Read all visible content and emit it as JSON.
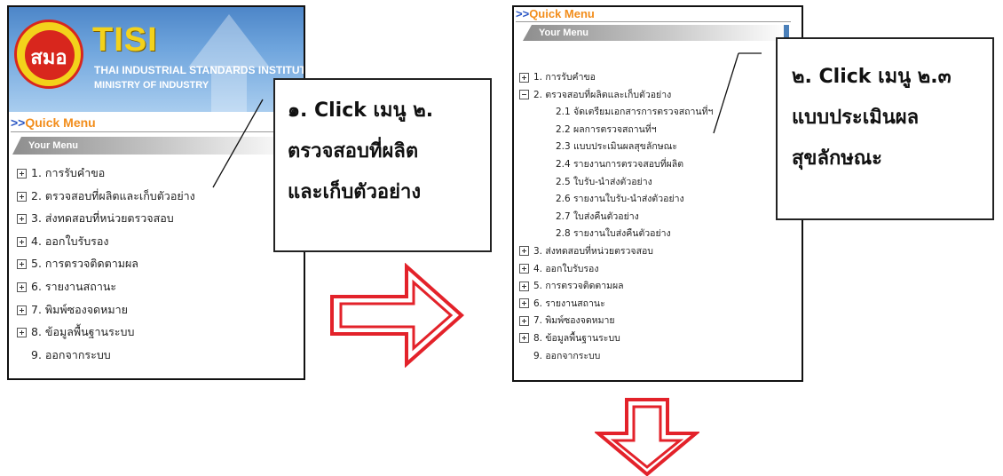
{
  "panel1": {
    "logo": {
      "abbrev": "สมอ",
      "brand": "TISI",
      "name_line1": "THAI INDUSTRIAL STANDARDS INSTITUTE",
      "name_line2": "MINISTRY OF INDUSTRY"
    },
    "quick_menu": {
      "prefix": ">>",
      "label": "Quick Menu"
    },
    "your_menu": "Your Menu",
    "menu_items": [
      {
        "label": "1. การรับคำขอ",
        "icon": "plus-box-icon"
      },
      {
        "label": "2. ตรวจสอบที่ผลิตและเก็บตัวอย่าง",
        "icon": "plus-box-icon"
      },
      {
        "label": "3. ส่งทดสอบที่หน่วยตรวจสอบ",
        "icon": "plus-box-icon"
      },
      {
        "label": "4. ออกใบรับรอง",
        "icon": "plus-box-icon"
      },
      {
        "label": "5. การตรวจติดตามผล",
        "icon": "plus-box-icon"
      },
      {
        "label": "6. รายงานสถานะ",
        "icon": "plus-box-icon"
      },
      {
        "label": "7. พิมพ์ซองจดหมาย",
        "icon": "plus-box-icon"
      },
      {
        "label": "8. ข้อมูลพื้นฐานระบบ",
        "icon": "plus-box-icon"
      },
      {
        "label": "9. ออกจากระบบ",
        "icon": "none"
      }
    ]
  },
  "callout1": {
    "lines": [
      "๑. Click เมนู ๒.",
      "ตรวจสอบที่ผลิต",
      "และเก็บตัวอย่าง"
    ]
  },
  "panel2": {
    "quick_menu": {
      "prefix": ">>",
      "label": "Quick Menu"
    },
    "your_menu": "Your Menu",
    "menu_items": [
      {
        "label": "1. การรับคำขอ",
        "icon": "plus-box-icon"
      },
      {
        "label": "2. ตรวจสอบที่ผลิตและเก็บตัวอย่าง",
        "icon": "minus-box-icon"
      },
      {
        "label": "2.1 จัดเตรียมเอกสารการตรวจสถานที่ฯ",
        "sub": true
      },
      {
        "label": "2.2 ผลการตรวจสถานที่ฯ",
        "sub": true
      },
      {
        "label": "2.3 แบบประเมินผลสุขลักษณะ",
        "sub": true
      },
      {
        "label": "2.4 รายงานการตรวจสอบที่ผลิต",
        "sub": true
      },
      {
        "label": "2.5 ใบรับ-นำส่งตัวอย่าง",
        "sub": true
      },
      {
        "label": "2.6 รายงานใบรับ-นำส่งตัวอย่าง",
        "sub": true
      },
      {
        "label": "2.7 ใบส่งคืนตัวอย่าง",
        "sub": true
      },
      {
        "label": "2.8 รายงานใบส่งคืนตัวอย่าง",
        "sub": true
      },
      {
        "label": "3. ส่งทดสอบที่หน่วยตรวจสอบ",
        "icon": "plus-box-icon"
      },
      {
        "label": "4. ออกใบรับรอง",
        "icon": "plus-box-icon"
      },
      {
        "label": "5. การตรวจติดตามผล",
        "icon": "plus-box-icon"
      },
      {
        "label": "6. รายงานสถานะ",
        "icon": "plus-box-icon"
      },
      {
        "label": "7. พิมพ์ซองจดหมาย",
        "icon": "plus-box-icon"
      },
      {
        "label": "8. ข้อมูลพื้นฐานระบบ",
        "icon": "plus-box-icon"
      },
      {
        "label": "9. ออกจากระบบ",
        "icon": "none"
      }
    ]
  },
  "callout2": {
    "lines": [
      "๒. Click เมนู ๒.๓",
      "แบบประเมินผล",
      "สุขลักษณะ"
    ]
  },
  "colors": {
    "arrow": "#e3222a",
    "quick_menu_orange": "#f28d1b",
    "quick_menu_blue": "#2b57c5"
  },
  "arrows": [
    {
      "name": "right-arrow-icon",
      "direction": "right"
    },
    {
      "name": "down-arrow-icon",
      "direction": "down"
    }
  ]
}
